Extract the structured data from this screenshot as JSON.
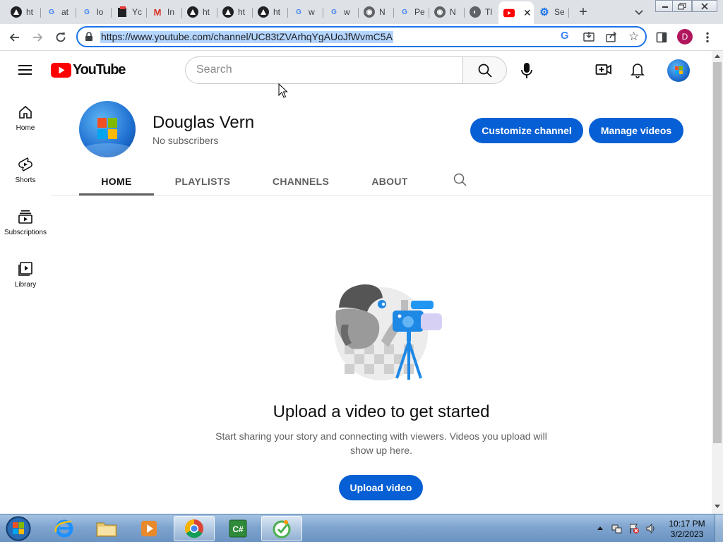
{
  "browser": {
    "tabs": [
      {
        "label": "ht",
        "icon": "google-account-icon"
      },
      {
        "label": "at",
        "icon": "google-icon"
      },
      {
        "label": "lo",
        "icon": "google-icon"
      },
      {
        "label": "Yc",
        "icon": "youtube-studio-icon"
      },
      {
        "label": "In",
        "icon": "gmail-icon"
      },
      {
        "label": "ht",
        "icon": "google-account-icon"
      },
      {
        "label": "ht",
        "icon": "google-account-icon"
      },
      {
        "label": "ht",
        "icon": "google-account-icon"
      },
      {
        "label": "w",
        "icon": "google-icon"
      },
      {
        "label": "w",
        "icon": "google-icon"
      },
      {
        "label": "N",
        "icon": "chrome-icon"
      },
      {
        "label": "Pe",
        "icon": "google-icon"
      },
      {
        "label": "N",
        "icon": "chrome-icon"
      },
      {
        "label": "Tl",
        "icon": "globe-icon"
      },
      {
        "label": "",
        "icon": "youtube-icon",
        "active": true
      },
      {
        "label": "Se",
        "icon": "settings-gear-icon"
      }
    ],
    "url": "https://www.youtube.com/channel/UC83tZVArhqYgAUoJfWvmC5A",
    "profile_initial": "D"
  },
  "youtube": {
    "logo_text": "YouTube",
    "search_placeholder": "Search",
    "guide": [
      {
        "label": "Home",
        "icon": "home-icon"
      },
      {
        "label": "Shorts",
        "icon": "shorts-icon"
      },
      {
        "label": "Subscriptions",
        "icon": "subscriptions-icon"
      },
      {
        "label": "Library",
        "icon": "library-icon"
      }
    ],
    "channel": {
      "name": "Douglas Vern",
      "subscribers": "No subscribers",
      "customize_label": "Customize channel",
      "manage_label": "Manage videos"
    },
    "tabs": [
      "HOME",
      "PLAYLISTS",
      "CHANNELS",
      "ABOUT"
    ],
    "active_tab": "HOME",
    "empty_state": {
      "title": "Upload a video to get started",
      "description": "Start sharing your story and connecting with viewers. Videos you upload will show up here.",
      "button": "Upload video"
    }
  },
  "taskbar": {
    "time": "10:17 PM",
    "date": "3/2/2023"
  },
  "colors": {
    "accent_blue": "#065fd4",
    "youtube_red": "#ff0000",
    "chrome_focus": "#1a73e8"
  }
}
